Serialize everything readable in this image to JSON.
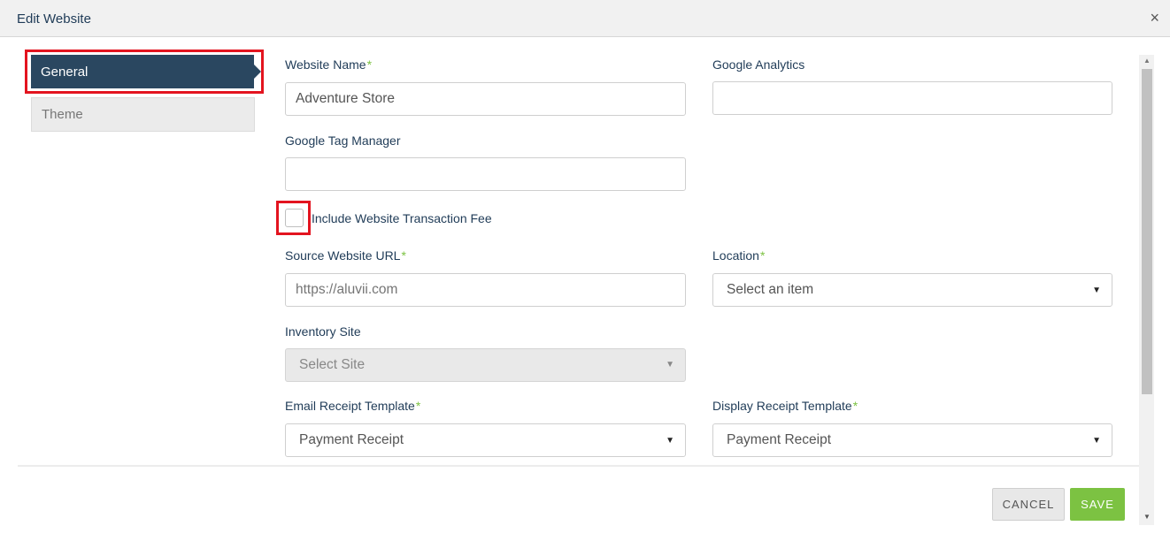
{
  "dialog": {
    "title": "Edit Website",
    "close_glyph": "×"
  },
  "nav": {
    "items": [
      {
        "label": "General",
        "active": true
      },
      {
        "label": "Theme",
        "active": false
      }
    ]
  },
  "form": {
    "website_name": {
      "label": "Website Name",
      "required": "*",
      "value": "Adventure Store"
    },
    "google_analytics": {
      "label": "Google Analytics",
      "value": ""
    },
    "google_tag_manager": {
      "label": "Google Tag Manager",
      "value": ""
    },
    "transaction_fee": {
      "label": "Include Website Transaction Fee",
      "checked": false
    },
    "source_url": {
      "label": "Source Website URL",
      "required": "*",
      "placeholder": "https://aluvii.com"
    },
    "location": {
      "label": "Location",
      "required": "*",
      "selected": "Select an item"
    },
    "inventory_site": {
      "label": "Inventory Site",
      "selected": "Select Site",
      "disabled": true
    },
    "email_receipt": {
      "label": "Email Receipt Template",
      "required": "*",
      "selected": "Payment Receipt"
    },
    "display_receipt": {
      "label": "Display Receipt Template",
      "required": "*",
      "selected": "Payment Receipt"
    }
  },
  "footer": {
    "cancel_label": "CANCEL",
    "save_label": "SAVE"
  },
  "icons": {
    "caret": "▼",
    "scroll_up": "▲",
    "scroll_down": "▼"
  },
  "colors": {
    "nav_active": "#2a4760",
    "required": "#7cc242",
    "save": "#7cc242",
    "highlight": "#e3141f"
  }
}
